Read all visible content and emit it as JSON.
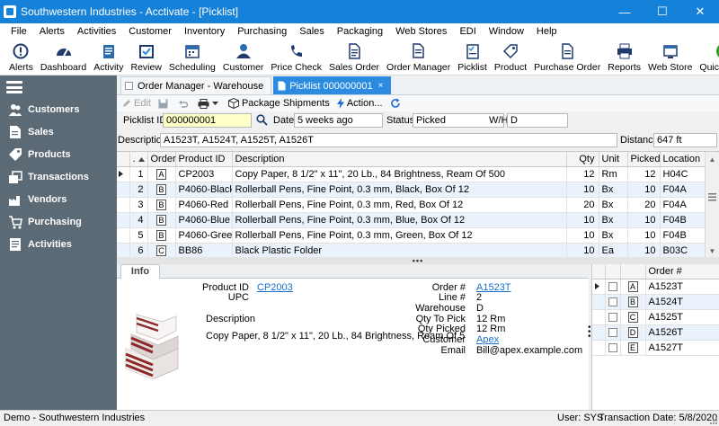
{
  "window": {
    "title": "Southwestern Industries - Acctivate - [Picklist]",
    "minimize": "—",
    "maximize": "☐",
    "close": "✕"
  },
  "menu": [
    "File",
    "Alerts",
    "Activities",
    "Customer",
    "Inventory",
    "Purchasing",
    "Sales",
    "Packaging",
    "Web Stores",
    "EDI",
    "Window",
    "Help"
  ],
  "toolbar": [
    {
      "label": "Alerts",
      "icon": "alert-icon"
    },
    {
      "label": "Dashboard",
      "icon": "dashboard-icon"
    },
    {
      "label": "Activity",
      "icon": "activity-icon"
    },
    {
      "label": "Review",
      "icon": "review-icon"
    },
    {
      "label": "Scheduling",
      "icon": "scheduling-icon"
    },
    {
      "label": "Customer",
      "icon": "customer-icon"
    },
    {
      "label": "Price Check",
      "icon": "price-check-icon"
    },
    {
      "label": "Sales Order",
      "icon": "sales-order-icon"
    },
    {
      "label": "Order Manager",
      "icon": "order-manager-icon"
    },
    {
      "label": "Picklist",
      "icon": "picklist-icon"
    },
    {
      "label": "Product",
      "icon": "product-icon"
    },
    {
      "label": "Purchase Order",
      "icon": "purchase-order-icon"
    },
    {
      "label": "Reports",
      "icon": "reports-icon"
    },
    {
      "label": "Web Store",
      "icon": "web-store-icon"
    },
    {
      "label": "QuickBooks",
      "icon": "quickbooks-icon"
    }
  ],
  "sidebar": {
    "items": [
      {
        "label": "Customers",
        "icon": "customers-icon"
      },
      {
        "label": "Sales",
        "icon": "sales-icon"
      },
      {
        "label": "Products",
        "icon": "products-icon"
      },
      {
        "label": "Transactions",
        "icon": "transactions-icon"
      },
      {
        "label": "Vendors",
        "icon": "vendors-icon"
      },
      {
        "label": "Purchasing",
        "icon": "purchasing-icon"
      },
      {
        "label": "Activities",
        "icon": "activities-icon"
      }
    ]
  },
  "tabs": [
    {
      "label": "Order Manager - Warehouse",
      "active": false
    },
    {
      "label": "Picklist 000000001",
      "active": true,
      "close": "×"
    }
  ],
  "actions": {
    "edit": "Edit",
    "package_shipments": "Package Shipments",
    "action": "Action..."
  },
  "form": {
    "picklist_id_label": "Picklist ID",
    "picklist_id": "000000001",
    "date_label": "Date",
    "date": "5 weeks ago",
    "status_label": "Status",
    "status": "Picked",
    "wh_label": "W/H",
    "wh": "D",
    "description_label": "Description",
    "description": "A1523T, A1524T, A1525T, A1526T",
    "distance_label": "Distance",
    "distance": "647 ft"
  },
  "grid": {
    "columns": [
      ".",
      "Order",
      "Product ID",
      "Description",
      "Qty",
      "Unit",
      "Picked",
      "Location"
    ],
    "rows": [
      {
        "n": "1",
        "order": "A",
        "product": "CP2003",
        "desc": "Copy Paper, 8 1/2\" x 11\", 20 Lb., 84 Brightness, Ream Of 500",
        "qty": "12",
        "unit": "Rm",
        "picked": "12",
        "loc": "H04C"
      },
      {
        "n": "2",
        "order": "B",
        "product": "P4060-Black",
        "desc": "Rollerball Pens, Fine Point, 0.3 mm, Black, Box Of 12",
        "qty": "10",
        "unit": "Bx",
        "picked": "10",
        "loc": "F04A"
      },
      {
        "n": "3",
        "order": "B",
        "product": "P4060-Red",
        "desc": "Rollerball Pens, Fine Point, 0.3 mm, Red, Box Of 12",
        "qty": "20",
        "unit": "Bx",
        "picked": "20",
        "loc": "F04A"
      },
      {
        "n": "4",
        "order": "B",
        "product": "P4060-Blue",
        "desc": "Rollerball Pens, Fine Point, 0.3 mm, Blue, Box Of 12",
        "qty": "10",
        "unit": "Bx",
        "picked": "10",
        "loc": "F04B"
      },
      {
        "n": "5",
        "order": "B",
        "product": "P4060-Green",
        "desc": "Rollerball Pens, Fine Point, 0.3 mm, Green, Box Of 12",
        "qty": "10",
        "unit": "Bx",
        "picked": "10",
        "loc": "F04B"
      },
      {
        "n": "6",
        "order": "C",
        "product": "BB86",
        "desc": "Black Plastic Folder",
        "qty": "10",
        "unit": "Ea",
        "picked": "10",
        "loc": "B03C"
      }
    ]
  },
  "splitter": "•••",
  "info": {
    "tab": "Info",
    "product_id_label": "Product ID",
    "product_id": "CP2003",
    "upc_label": "UPC",
    "description_label": "Description",
    "description": "Copy Paper, 8 1/2\" x 11\", 20 Lb., 84 Brightness, Ream Of 5",
    "order_label": "Order #",
    "order": "A1523T",
    "line_label": "Line #",
    "line": "2",
    "warehouse_label": "Warehouse",
    "warehouse": "D",
    "qty_to_pick_label": "Qty To Pick",
    "qty_to_pick": "12 Rm",
    "qty_picked_label": "Qty Picked",
    "qty_picked": "12 Rm",
    "customer_label": "Customer",
    "customer": "Apex",
    "email_label": "Email",
    "email": "Bill@apex.example.com"
  },
  "orders": {
    "header": "Order #",
    "rows": [
      {
        "letter": "A",
        "order": "A1523T"
      },
      {
        "letter": "B",
        "order": "A1524T"
      },
      {
        "letter": "C",
        "order": "A1525T"
      },
      {
        "letter": "D",
        "order": "A1526T"
      },
      {
        "letter": "E",
        "order": "A1527T"
      }
    ]
  },
  "status": {
    "left": "Demo - Southwestern Industries",
    "user": "User: SYS",
    "date": "Transaction Date: 5/8/2020"
  },
  "colors": {
    "titlebar": "#1681d8",
    "sidebar": "#5c6a76",
    "active_tab": "#2b8be0",
    "link": "#1a6fd0"
  }
}
